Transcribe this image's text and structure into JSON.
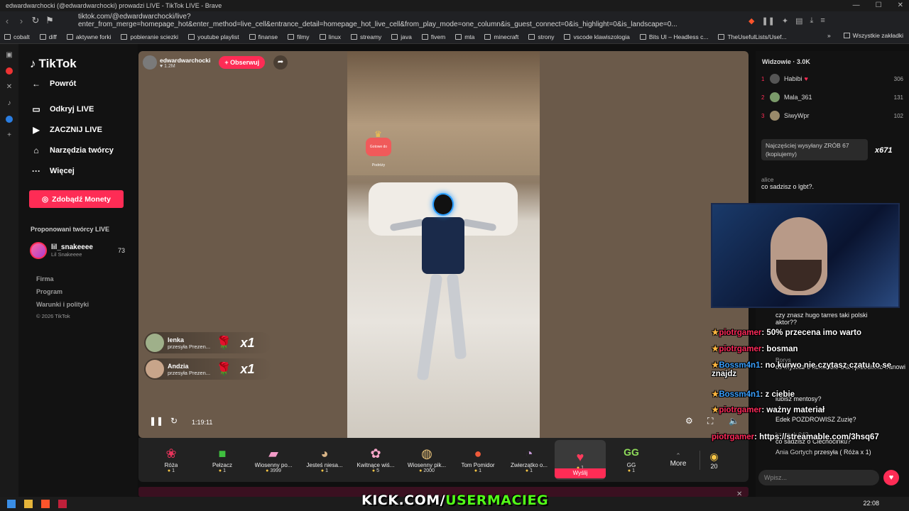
{
  "browser": {
    "window_title": "edwardwarchocki (@edwardwarchocki) prowadzi LIVE - TikTok LIVE - Brave",
    "url": "tiktok.com/@edwardwarchocki/live?enter_from_merge=homepage_hot&enter_method=live_cell&entrance_detail=homepage_hot_live_cell&from_play_mode=one_column&is_guest_connect=0&is_highlight=0&is_landscape=0...",
    "bookmarks": [
      "cobalt",
      "diff",
      "aktywne forki",
      "pobieranie sciezki",
      "youtube playlist",
      "finanse",
      "filmy",
      "linux",
      "streamy",
      "java",
      "fivem",
      "mta",
      "minecraft",
      "strony",
      "vscode klawiszologia",
      "Bits UI – Headless c...",
      "TheUsefulLists/Usef..."
    ],
    "bookmarks_all": "Wszystkie zakładki"
  },
  "sidebar": {
    "logo": "TikTok",
    "back": "Powrót",
    "items": [
      "Odkryj LIVE",
      "ZACZNIJ LIVE",
      "Narzędzia twórcy",
      "Więcej"
    ],
    "coins_button": "Zdobądź Monety",
    "proposed_heading": "Proponowani twórcy LIVE",
    "creator": {
      "name": "lil_snakeeee",
      "sub": "Lil Snakeeee",
      "count": "73"
    },
    "footer": [
      "Firma",
      "Program",
      "Warunki i polityki",
      "© 2026 TikTok"
    ]
  },
  "player": {
    "host_name": "edwardwarchocki",
    "host_followers": "1.2M",
    "follow_button": "+ Obserwuj",
    "badge_text": "Gotowe do Podróży",
    "gift_notifications": [
      {
        "user": "lenka",
        "text": "przesyła Prezen...",
        "count": "x1"
      },
      {
        "user": "Andzia",
        "text": "przesyła Prezen...",
        "count": "x1"
      }
    ],
    "elapsed": "1:19:11"
  },
  "gifts": [
    {
      "name": "Róża",
      "price": "1",
      "icon": "rose"
    },
    {
      "name": "Pełzacz",
      "price": "1",
      "icon": "creeper"
    },
    {
      "name": "Wiosenny po...",
      "price": "3999",
      "icon": "spring-car"
    },
    {
      "name": "Jesteś niesa...",
      "price": "1",
      "icon": "cat"
    },
    {
      "name": "Kwitnące wiś...",
      "price": "5",
      "icon": "blossom"
    },
    {
      "name": "Wiosenny pik...",
      "price": "2000",
      "icon": "picnic"
    },
    {
      "name": "Tom Pomidor",
      "price": "1",
      "icon": "tomato"
    },
    {
      "name": "Zwierzątko o...",
      "price": "1",
      "icon": "pet"
    },
    {
      "name": "",
      "price": "1",
      "icon": "lips"
    },
    {
      "name": "GG",
      "price": "1",
      "icon": "gg"
    }
  ],
  "gift_send": "Wyślij",
  "gift_more": "More",
  "coin_balance": "20",
  "viewers": {
    "heading": "Widzowie · 3.0K",
    "list": [
      {
        "rank": "1",
        "name": "Habibi",
        "score": "306"
      },
      {
        "rank": "2",
        "name": "Mala_361",
        "score": "131"
      },
      {
        "rank": "3",
        "name": "SiwyWpr",
        "score": "102"
      }
    ]
  },
  "top_gift": {
    "text": "Najczęściej wysyłany ZRÓB 67 (kopiujemy)",
    "multiplier": "x671"
  },
  "chat": [
    {
      "user": "alice",
      "text": "co sadzisz o lgbt?."
    },
    {
      "user": "",
      "text": "czy znasz hugo tarres taki polski aktor??"
    },
    {
      "user": "Borys",
      "text": "co myslisz o konflikcie USA przeciwko Iranowi"
    },
    {
      "user": "",
      "text": "lubisz mentosy?"
    },
    {
      "user": "",
      "text": "Edek POZDROWISZ Zuzię?"
    },
    {
      "user": "kampok 042",
      "text": "co sadzisz o Ciechocinku?"
    },
    {
      "user": "Ania Gortych",
      "text": "przesyła ( Róża x 1)"
    }
  ],
  "overlay_chat": [
    {
      "user": "piotrgamer",
      "text": "50% przecena imo warto",
      "color": "#ff2a5a"
    },
    {
      "user": "piotrgamer",
      "text": "bosman",
      "color": "#ff2a5a"
    },
    {
      "user": "Bossm4n1",
      "text": "no kurwo nie czytasz czatu to se znajdz",
      "color": "#3aa0ff"
    },
    {
      "user": "Bossm4n1",
      "text": "z ciebie",
      "color": "#3aa0ff"
    },
    {
      "user": "piotrgamer",
      "text": "ważny materiał",
      "color": "#ff2a5a"
    },
    {
      "user": "piotrgamer",
      "text": "https://streamable.com/3hsq67",
      "color": "#ff2a5a"
    }
  ],
  "chat_input_placeholder": "Wpisz...",
  "stream_banner": {
    "prefix": "KICK.COM/",
    "accent": "USERMACIEG"
  },
  "clock": "22:08"
}
